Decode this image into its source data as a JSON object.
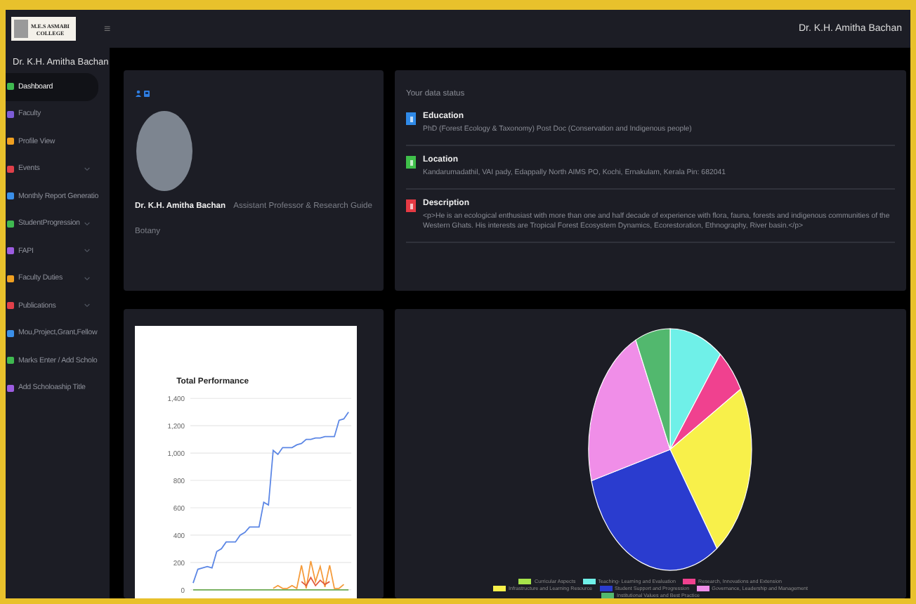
{
  "topbar": {
    "logo_lines": [
      "M.E.S ASMABI",
      "COLLEGE"
    ],
    "menu_glyph": "≡",
    "user_name": "Dr. K.H. Amitha Bachan"
  },
  "sidebar": {
    "user_name": "Dr. K.H. Amitha Bachan",
    "items": [
      {
        "label": "Dashboard",
        "selected": true,
        "has_submenu": false,
        "color": "#3fb950"
      },
      {
        "label": "Faculty",
        "selected": false,
        "has_submenu": false,
        "color": "#7c5cd6"
      },
      {
        "label": "Profile View",
        "selected": false,
        "has_submenu": false,
        "color": "#f0a020"
      },
      {
        "label": "Events",
        "selected": false,
        "has_submenu": true,
        "color": "#e0404a"
      },
      {
        "label": "Monthly Report Generatio",
        "selected": false,
        "has_submenu": false,
        "color": "#3a8fe8"
      },
      {
        "label": "StudentProgression",
        "selected": false,
        "has_submenu": true,
        "color": "#3fb950"
      },
      {
        "label": "FAPI",
        "selected": false,
        "has_submenu": true,
        "color": "#9c5ce0"
      },
      {
        "label": "Faculty Duties",
        "selected": false,
        "has_submenu": true,
        "color": "#f0a020"
      },
      {
        "label": "Publications",
        "selected": false,
        "has_submenu": true,
        "color": "#e0404a"
      },
      {
        "label": "Mou,Project,Grant,Fellow",
        "selected": false,
        "has_submenu": false,
        "color": "#3a8fe8"
      },
      {
        "label": "Marks Enter / Add Scholo",
        "selected": false,
        "has_submenu": false,
        "color": "#3fb950"
      },
      {
        "label": "Add Scholoaship Title",
        "selected": false,
        "has_submenu": false,
        "color": "#9c5ce0"
      }
    ]
  },
  "profile": {
    "name": "Dr. K.H. Amitha Bachan",
    "role": "Assistant Professor & Research Guide",
    "department": "Botany"
  },
  "data_status": {
    "title": "Your data status",
    "items": [
      {
        "title": "Education",
        "text": "PhD (Forest Ecology & Taxonomy) Post Doc (Conservation and Indigenous people)",
        "color": "#2f8ae8"
      },
      {
        "title": "Location",
        "text": "Kandarumadathil, VAI pady, Edappally North AIMS PO, Kochi, Ernakulam, Kerala Pin: 682041",
        "color": "#3fc04a"
      },
      {
        "title": "Description",
        "text": "<p>He is an ecological enthusiast with more than one and half decade of experience with flora, fauna, forests and indigenous communities of the Western Ghats. His interests are Tropical Forest Ecosystem Dynamics, Ecorestoration, Ethnography, River basin.</p>",
        "color": "#e53a44"
      }
    ]
  },
  "performance": {
    "chart_data": {
      "type": "line",
      "title": "Total Performance",
      "grid": true,
      "ylim": [
        0,
        1400
      ],
      "yticks": [
        {
          "value": 0,
          "label": "0"
        },
        {
          "value": 200,
          "label": "200"
        },
        {
          "value": 400,
          "label": "400"
        },
        {
          "value": 600,
          "label": "600"
        },
        {
          "value": 800,
          "label": "800"
        },
        {
          "value": 1000,
          "label": "1,000"
        },
        {
          "value": 1200,
          "label": "1,200"
        },
        {
          "value": 1400,
          "label": "1,400"
        }
      ],
      "series": [
        {
          "color": "#5b86e5",
          "values": [
            50,
            150,
            160,
            170,
            160,
            280,
            300,
            350,
            350,
            350,
            400,
            420,
            460,
            460,
            460,
            640,
            620,
            1020,
            990,
            1040,
            1040,
            1040,
            1060,
            1070,
            1100,
            1100,
            1110,
            1110,
            1120,
            1120,
            1120,
            1240,
            1250,
            1300
          ]
        },
        {
          "color": "#e05a3a",
          "values": [
            null,
            null,
            null,
            null,
            null,
            null,
            null,
            null,
            null,
            null,
            null,
            null,
            null,
            null,
            null,
            null,
            null,
            null,
            null,
            null,
            null,
            null,
            null,
            60,
            30,
            90,
            30,
            70,
            40,
            60,
            null,
            null,
            null,
            null
          ]
        },
        {
          "color": "#f59b3a",
          "values": [
            null,
            null,
            null,
            null,
            null,
            null,
            null,
            null,
            null,
            null,
            null,
            null,
            null,
            null,
            null,
            null,
            null,
            10,
            30,
            10,
            10,
            30,
            10,
            180,
            10,
            210,
            60,
            170,
            20,
            180,
            10,
            10,
            40,
            null
          ]
        },
        {
          "color": "#6aa84f",
          "values": [
            0,
            0,
            0,
            0,
            0,
            0,
            0,
            0,
            0,
            0,
            0,
            0,
            0,
            0,
            0,
            0,
            0,
            0,
            0,
            0,
            0,
            0,
            0,
            0,
            0,
            0,
            0,
            0,
            0,
            0,
            0,
            0,
            0,
            0
          ]
        }
      ]
    }
  },
  "criteria": {
    "legend": [
      {
        "label": "Curricular Aspects",
        "color": "#a6e34a"
      },
      {
        "label": "Teaching- Learning and Evaluation",
        "color": "#6ff0e8"
      },
      {
        "label": "Research, Innovations and Extension",
        "color": "#f0418f"
      },
      {
        "label": "Infrastructure and Learning Resource",
        "color": "#f8f04a"
      },
      {
        "label": "Student Support and Progression",
        "color": "#2a3ccf"
      },
      {
        "label": "Governance, Leadership and Management",
        "color": "#f08ee8"
      },
      {
        "label": "Institutional Values and Best Practice",
        "color": "#52b86e"
      }
    ]
  }
}
